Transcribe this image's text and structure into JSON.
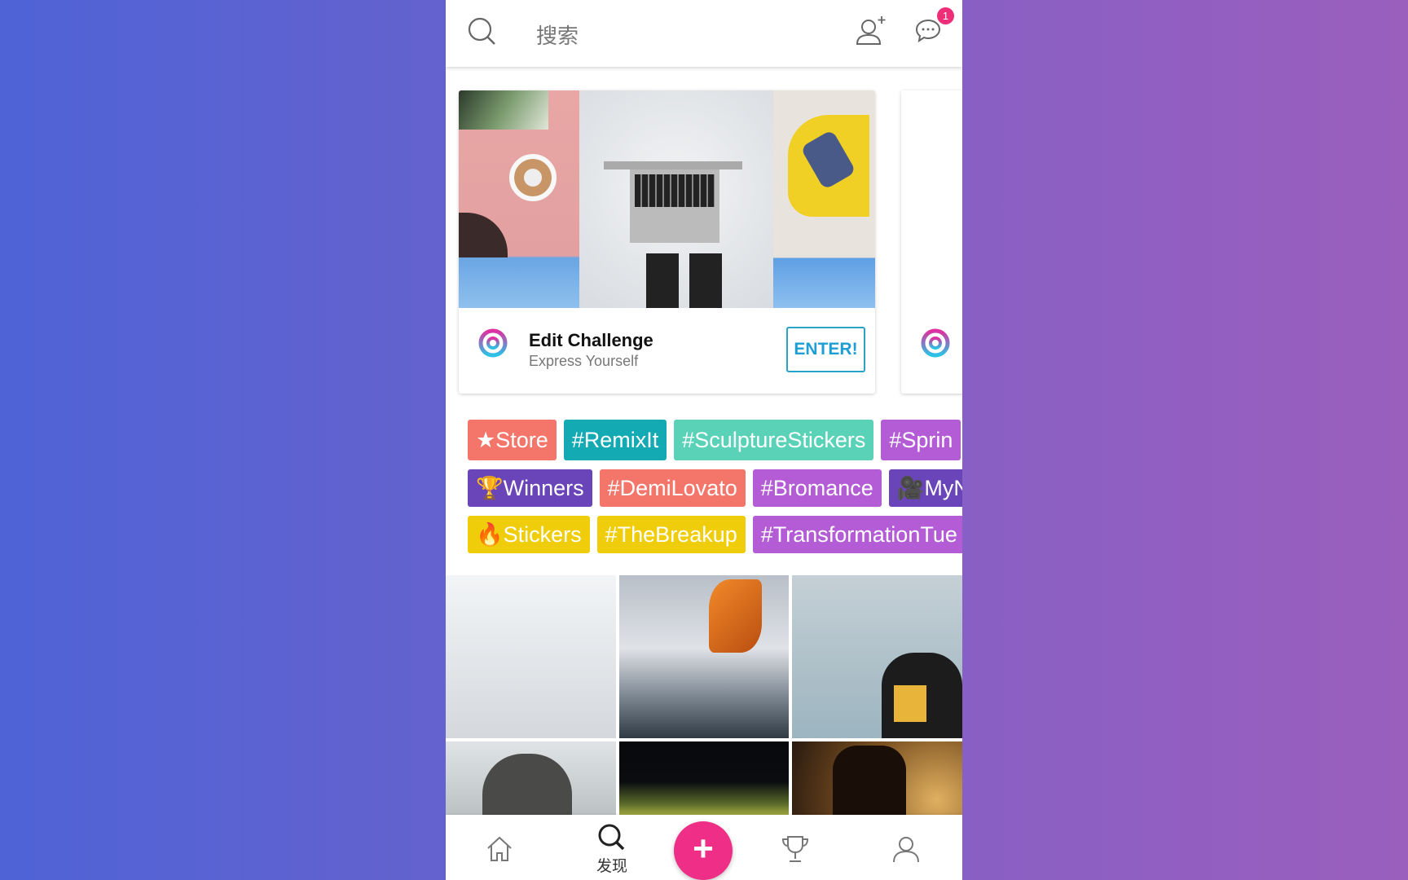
{
  "header": {
    "search_placeholder": "搜索",
    "icons": [
      "search-icon",
      "add-user-icon",
      "chat-icon"
    ],
    "notification_count": "1"
  },
  "challenge_card": {
    "title": "Edit Challenge",
    "subtitle": "Express Yourself",
    "button": "ENTER!"
  },
  "tags": [
    [
      {
        "label": "★Store",
        "color": "#f4766b"
      },
      {
        "label": "#RemixIt",
        "color": "#14aab4"
      },
      {
        "label": "#SculptureStickers",
        "color": "#5ad2b8"
      },
      {
        "label": "#Sprin",
        "color": "#b35cd6"
      }
    ],
    [
      {
        "label": "🏆Winners",
        "color": "#6a45b9"
      },
      {
        "label": "#DemiLovato",
        "color": "#f4766b"
      },
      {
        "label": "#Bromance",
        "color": "#b35cd6"
      },
      {
        "label": "🎥MyN",
        "color": "#6a45b9"
      }
    ],
    [
      {
        "label": "🔥Stickers",
        "color": "#f0cd0a"
      },
      {
        "label": "#TheBreakup",
        "color": "#f0cd0a"
      },
      {
        "label": "#TransformationTue",
        "color": "#b35cd6"
      }
    ]
  ],
  "nav": {
    "discover_label": "发现",
    "fab": "+",
    "items": [
      "home-icon",
      "search-icon",
      "plus-button",
      "trophy-icon",
      "profile-icon"
    ]
  },
  "colors": {
    "accent": "#ef2e87",
    "enter": "#1e9ed2"
  }
}
